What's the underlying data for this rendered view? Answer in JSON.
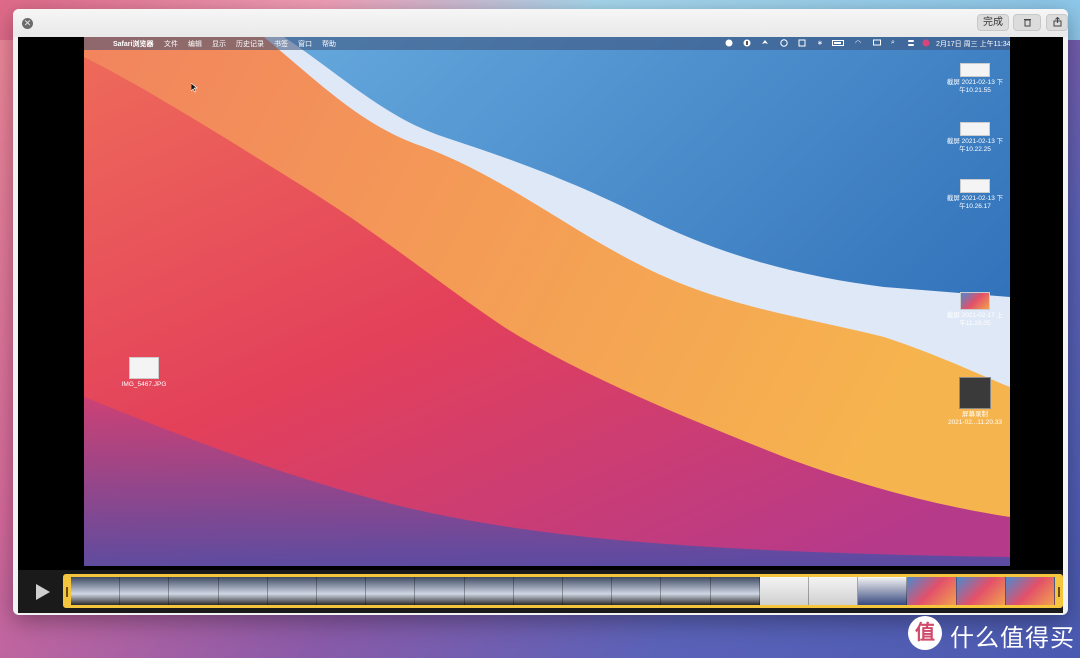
{
  "titlebar": {
    "done_label": "完成",
    "trash_icon": "trash-icon",
    "share_icon": "share-icon"
  },
  "menubar": {
    "apple_icon": "apple-icon",
    "items": [
      "Safari浏览器",
      "文件",
      "编辑",
      "显示",
      "历史记录",
      "书签",
      "窗口",
      "帮助"
    ],
    "status_icons": [
      "circle-x-icon",
      "user-icon",
      "bird-icon",
      "play-circle-icon",
      "text-box-icon",
      "bluetooth-icon",
      "battery-icon",
      "wifi-icon",
      "display-icon",
      "search-icon",
      "control-center-icon",
      "siri-icon"
    ],
    "datetime": "2月17日 周三 上午11:34"
  },
  "desktop": {
    "left_icon": {
      "label": "IMG_5467.JPG"
    },
    "right_icons": [
      {
        "line1": "截屏 2021-02-13 下",
        "line2": "午10.21.55"
      },
      {
        "line1": "截屏 2021-02-13 下",
        "line2": "午10.22.25"
      },
      {
        "line1": "截屏 2021-02-13 下",
        "line2": "午10.26.17"
      },
      {
        "line1": "截屏 2021-02-17 上",
        "line2": "午11.28.05"
      },
      {
        "line1": "屏幕录制",
        "line2": "2021-02...11.20.33"
      }
    ]
  },
  "timeline": {
    "play_icon": "play-icon",
    "frame_count": 20
  },
  "watermark": {
    "logo_text": "值",
    "text": "什么值得买"
  },
  "colors": {
    "accent_yellow": "#f4c53d",
    "window_bg": "#f2f2f2"
  }
}
